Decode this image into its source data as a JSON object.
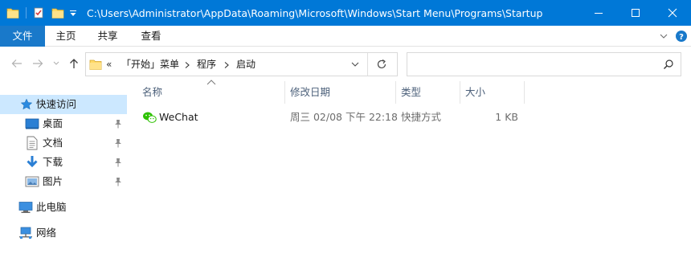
{
  "window": {
    "path": "C:\\Users\\Administrator\\AppData\\Roaming\\Microsoft\\Windows\\Start Menu\\Programs\\Startup",
    "accent_color": "#0078d7"
  },
  "ribbon": {
    "tabs": [
      {
        "label": "文件",
        "active": true
      },
      {
        "label": "主页"
      },
      {
        "label": "共享"
      },
      {
        "label": "查看"
      }
    ]
  },
  "address": {
    "overflow": "«",
    "crumbs": [
      "「开始」菜单",
      "程序",
      "启动"
    ]
  },
  "search": {
    "placeholder": "",
    "value": ""
  },
  "nav": {
    "quick_access": "快速访问",
    "items": [
      {
        "label": "桌面",
        "icon": "desktop-icon",
        "pinned": true
      },
      {
        "label": "文档",
        "icon": "documents-icon",
        "pinned": true
      },
      {
        "label": "下载",
        "icon": "downloads-icon",
        "pinned": true
      },
      {
        "label": "图片",
        "icon": "pictures-icon",
        "pinned": true
      }
    ],
    "this_pc": "此电脑",
    "network": "网络"
  },
  "columns": {
    "name": "名称",
    "modified": "修改日期",
    "type": "类型",
    "size": "大小"
  },
  "files": [
    {
      "name": "WeChat",
      "modified": "周三 02/08 下午 22:18",
      "type": "快捷方式",
      "size": "1 KB",
      "icon": "wechat-icon"
    }
  ]
}
